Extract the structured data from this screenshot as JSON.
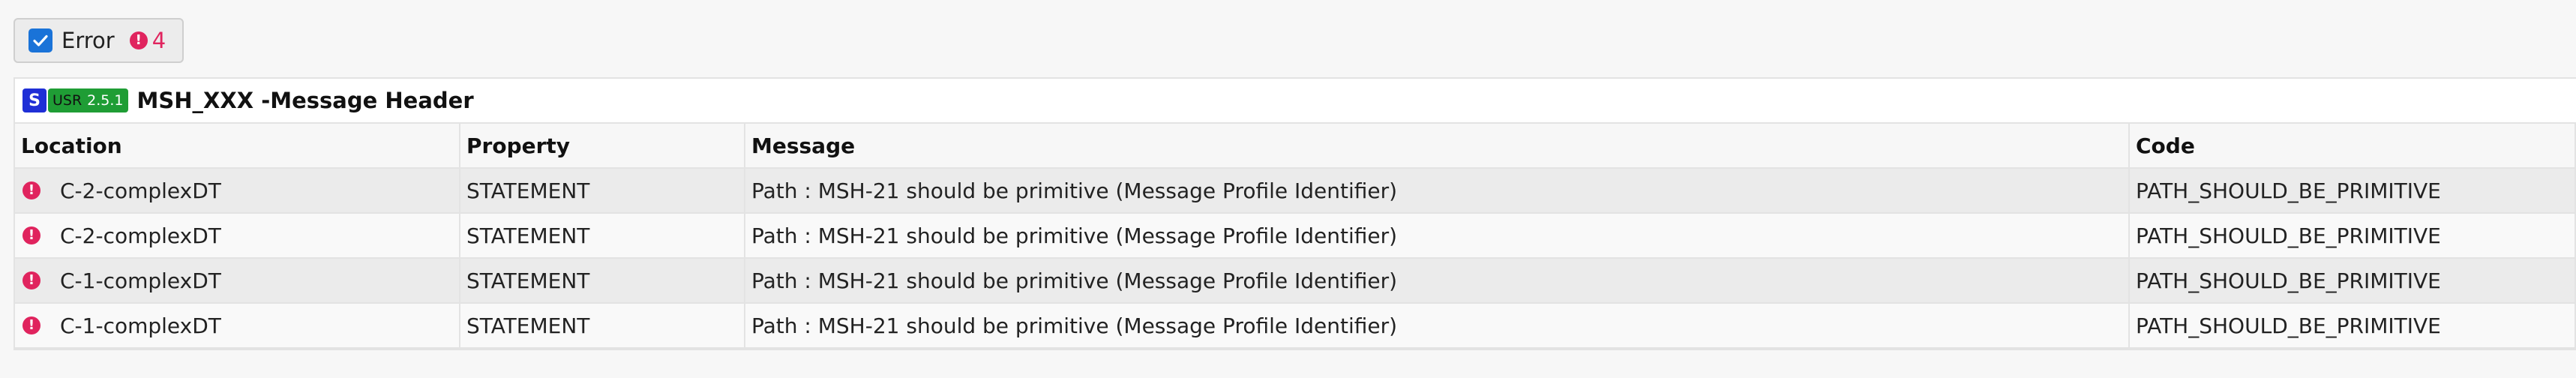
{
  "filter": {
    "label": "Error",
    "count": "4",
    "checked": true,
    "icon": "exclamation-circle-icon",
    "accent_color": "#1a73d8",
    "error_color": "#e0245e"
  },
  "panel": {
    "badge_s": "S",
    "badge_usr": "USR",
    "badge_version": "2.5.1",
    "title": "MSH_XXX -Message Header"
  },
  "table": {
    "headers": {
      "location": "Location",
      "property": "Property",
      "message": "Message",
      "code": "Code"
    },
    "rows": [
      {
        "location": "C-2-complexDT",
        "property": "STATEMENT",
        "message": "Path : MSH-21 should be primitive (Message Profile Identifier)",
        "code": "PATH_SHOULD_BE_PRIMITIVE"
      },
      {
        "location": "C-2-complexDT",
        "property": "STATEMENT",
        "message": "Path : MSH-21 should be primitive (Message Profile Identifier)",
        "code": "PATH_SHOULD_BE_PRIMITIVE"
      },
      {
        "location": "C-1-complexDT",
        "property": "STATEMENT",
        "message": "Path : MSH-21 should be primitive (Message Profile Identifier)",
        "code": "PATH_SHOULD_BE_PRIMITIVE"
      },
      {
        "location": "C-1-complexDT",
        "property": "STATEMENT",
        "message": "Path : MSH-21 should be primitive (Message Profile Identifier)",
        "code": "PATH_SHOULD_BE_PRIMITIVE"
      }
    ]
  }
}
